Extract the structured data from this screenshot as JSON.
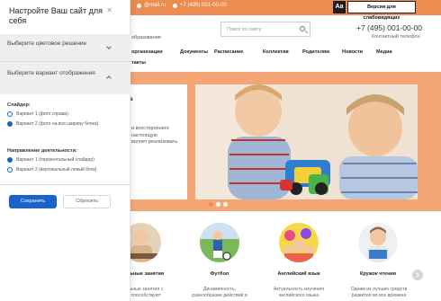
{
  "topbar": {
    "email": "@mail.ru",
    "phone": "+7 (495) 001-00-00",
    "ab_label": "Aa",
    "accessible_label": "Версия для слабовидящих"
  },
  "header": {
    "subtitle": "образования",
    "search_placeholder": "Поиск по сайту",
    "phone": "+7 (495) 001-00-00",
    "phone_caption": "Контактный телефон"
  },
  "nav": {
    "items": [
      "организации",
      "Документы",
      "Расписание",
      "Коллектив",
      "Родителям",
      "Новости",
      "Медиа"
    ],
    "extra": "такты"
  },
  "hero": {
    "title": "в",
    "text": "и всестороннего\nнастоящую\nволяет реализовать"
  },
  "activities": [
    {
      "title": "альные занятия",
      "desc": "альные занятия с\nи способствуют"
    },
    {
      "title": "Футбол",
      "desc": "Динамичность,\nразнообразие действий в"
    },
    {
      "title": "Английский язык",
      "desc": "Актуальность изучения\nанглийского языка"
    },
    {
      "title": "Кружок чтения",
      "desc": "Одним из лучших средств\nразвития во все времена"
    }
  ],
  "panel": {
    "title": "Настройте Ваш сайт для себя",
    "close": "×",
    "section_color": "Выберите цветовое решение",
    "section_display": "Выберите вариант отображения",
    "slider_label": "Слайдер:",
    "slider_options": [
      "Вариант 1 (фото справа)",
      "Вариант 2 (фото на всю ширину блока)"
    ],
    "slider_selected": 1,
    "direction_label": "Направление деятельности:",
    "direction_options": [
      "Вариант 1 (горизонтальный слайдер)",
      "Вариант 2 (вертикальный левый блок)"
    ],
    "direction_selected": 0,
    "save": "Сохранить",
    "reset": "Сбросить"
  },
  "colors": {
    "accent": "#ec8c4f",
    "hero_bg": "#f4a676",
    "primary_button": "#1c63c9"
  }
}
